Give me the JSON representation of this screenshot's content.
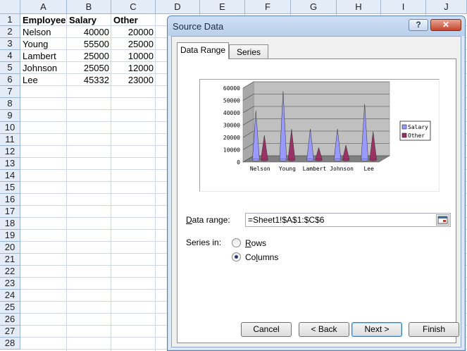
{
  "spreadsheet": {
    "columns": [
      "A",
      "B",
      "C",
      "D",
      "E",
      "F",
      "G",
      "H",
      "I",
      "J"
    ],
    "rows": [
      "1",
      "2",
      "3",
      "4",
      "5",
      "6",
      "7",
      "8",
      "9",
      "10",
      "11",
      "12",
      "13",
      "14",
      "15",
      "16",
      "17",
      "18",
      "19",
      "20",
      "21",
      "22",
      "23",
      "24",
      "25",
      "26",
      "27",
      "28"
    ],
    "header_row": [
      "Employee",
      "Salary",
      "Other"
    ],
    "data": [
      [
        "Nelson",
        "40000",
        "20000"
      ],
      [
        "Young",
        "55500",
        "25000"
      ],
      [
        "Lambert",
        "25000",
        "10000"
      ],
      [
        "Johnson",
        "25050",
        "12000"
      ],
      [
        "Lee",
        "45332",
        "23000"
      ]
    ]
  },
  "dialog": {
    "title": "Source Data",
    "help_label": "?",
    "close_label": "✕",
    "tabs": [
      "Data Range",
      "Series"
    ],
    "active_tab": "Data Range",
    "data_range_label": "Data range:",
    "data_range_value": "=Sheet1!$A$1:$C$6",
    "series_in_label": "Series in:",
    "series_options": [
      "Rows",
      "Columns"
    ],
    "series_selected": "Columns",
    "buttons": {
      "cancel": "Cancel",
      "back": "< Back",
      "next": "Next >",
      "finish": "Finish"
    }
  },
  "chart_data": {
    "type": "bar",
    "style": "3d-cone",
    "categories": [
      "Nelson",
      "Young",
      "Lambert",
      "Johnson",
      "Lee"
    ],
    "series": [
      {
        "name": "Salary",
        "values": [
          40000,
          55500,
          25000,
          25050,
          45332
        ],
        "color": "#9999ff"
      },
      {
        "name": "Other",
        "values": [
          20000,
          25000,
          10000,
          12000,
          23000
        ],
        "color": "#993366"
      }
    ],
    "ylim": [
      0,
      60000
    ],
    "yticks": [
      "0",
      "10000",
      "20000",
      "30000",
      "40000",
      "50000",
      "60000"
    ],
    "legend": "right",
    "grid": true
  }
}
